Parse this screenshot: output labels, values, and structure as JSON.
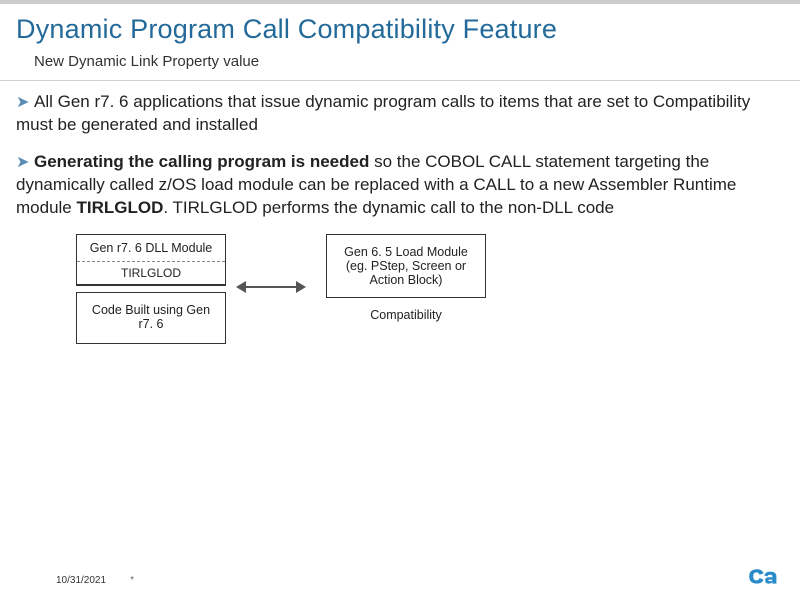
{
  "title": "Dynamic Program Call Compatibility Feature",
  "subtitle": "New Dynamic Link Property value",
  "bullets": [
    {
      "parts": [
        {
          "text": "All Gen r7. 6 applications that issue dynamic program calls  to items that are set to Compatibility must be generated and installed",
          "bold": false
        }
      ]
    },
    {
      "parts": [
        {
          "text": "Generating the calling program is needed",
          "bold": true
        },
        {
          "text": " so the  COBOL CALL statement targeting the dynamically called z/OS load module can be replaced with a CALL to a new Assembler Runtime module ",
          "bold": false
        },
        {
          "text": "TIRLGLOD",
          "bold": true
        },
        {
          "text": ".  TIRLGLOD performs the dynamic call to the non-DLL code",
          "bold": false
        }
      ]
    }
  ],
  "diagram": {
    "dll_module": "Gen r7. 6 DLL Module",
    "runtime": "TIRLGLOD",
    "code_built": "Code Built using Gen r7. 6",
    "load_module": "Gen 6. 5 Load Module (eg. PStep, Screen or Action Block)",
    "compat_label": "Compatibility"
  },
  "footer": {
    "date": "10/31/2021",
    "mark": "*"
  }
}
